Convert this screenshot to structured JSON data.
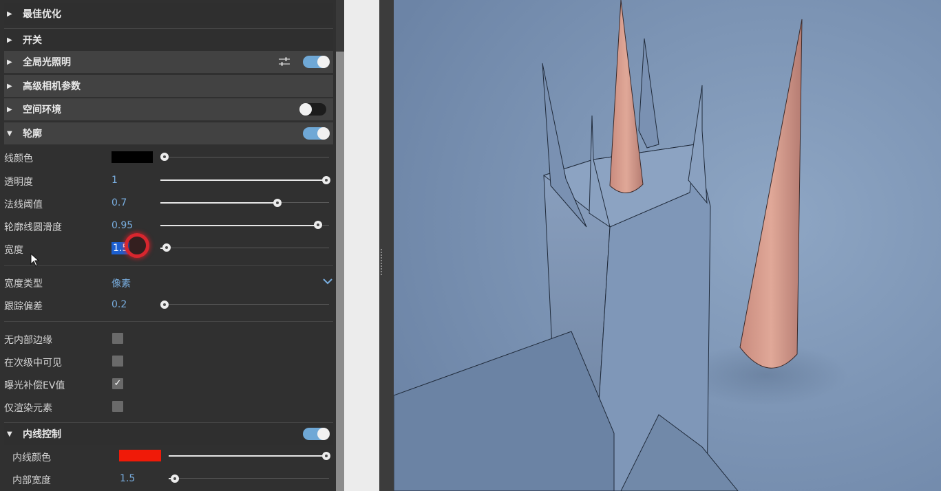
{
  "sections": {
    "best_optimization": "最佳优化",
    "switch": "开关",
    "global_illumination": "全局光照明",
    "advanced_camera": "高级相机参数",
    "spatial_environment": "空间环境",
    "outline": "轮廓",
    "inner_line_control": "内线控制"
  },
  "toggles": {
    "global_illumination": "on",
    "spatial_environment": "off",
    "outline": "on",
    "inner_line_control": "on"
  },
  "outline": {
    "line_color": {
      "label": "线颜色",
      "color": "#000000",
      "slider": 0.0
    },
    "opacity": {
      "label": "透明度",
      "value": "1",
      "slider": 1.0
    },
    "normal_threshold": {
      "label": "法线阈值",
      "value": "0.7",
      "slider": 0.7
    },
    "outline_smoothness": {
      "label": "轮廓线圆滑度",
      "value": "0.95",
      "slider": 0.95
    },
    "width": {
      "label": "宽度",
      "value": "1.5",
      "slider": 0.03
    },
    "width_type": {
      "label": "宽度类型",
      "value": "像素"
    },
    "tracking_offset": {
      "label": "跟踪偏差",
      "value": "0.2",
      "slider": 0.0
    },
    "no_inner_edges": {
      "label": "无内部边缘",
      "checked": false
    },
    "visible_in_children": {
      "label": "在次级中可见",
      "checked": false
    },
    "exposure_ev": {
      "label": "曝光补偿EV值",
      "checked": true
    },
    "render_elements_only": {
      "label": "仅渲染元素",
      "checked": false
    }
  },
  "inner_line": {
    "color": {
      "label": "内线颜色",
      "color": "#f01a08",
      "slider": 1.0
    },
    "width": {
      "label": "内部宽度",
      "value": "1.5",
      "slider": 0.03
    }
  },
  "icons": {
    "arrow_collapsed": "▶",
    "arrow_expanded": "▼",
    "checkmark": "✓",
    "settings": "sliders-icon",
    "chevron": "chevron-down-icon"
  },
  "colors": {
    "accent": "#79aee0",
    "toggle_on": "#6fa8d6",
    "viewport_bg": "#7890b0",
    "cone": "#d59b8a"
  }
}
